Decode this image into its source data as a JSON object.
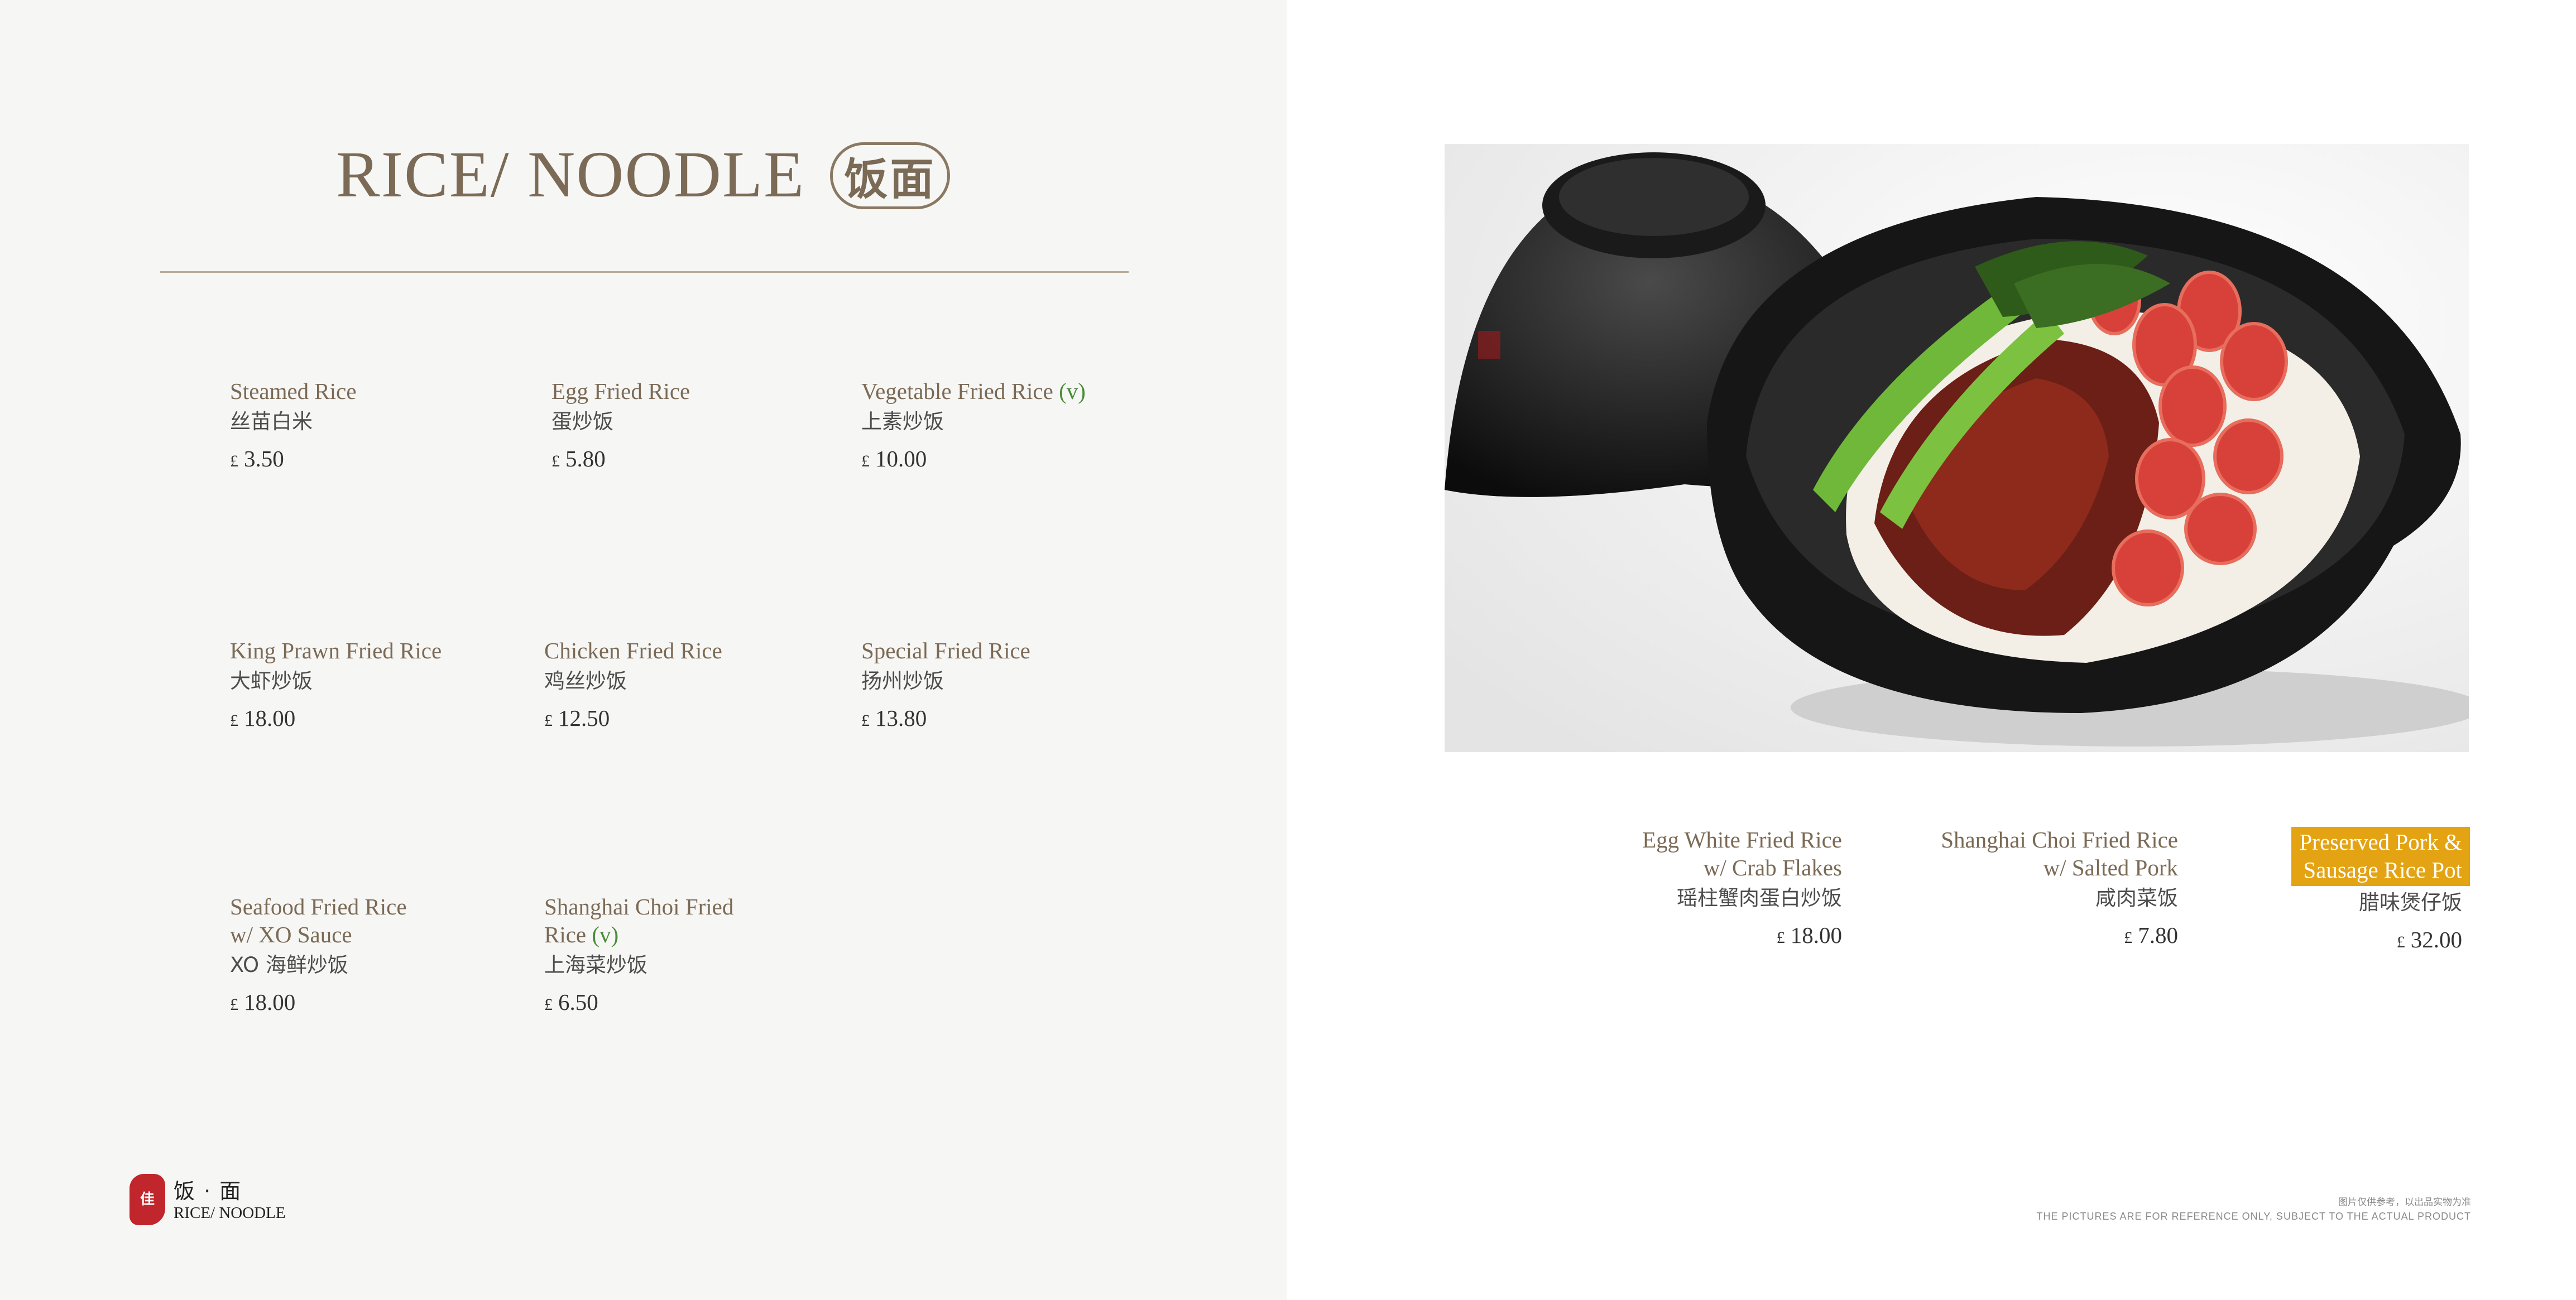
{
  "header": {
    "title": "RICE/ NOODLE",
    "badge": "饭面"
  },
  "menu_left": [
    {
      "en": "Steamed Rice",
      "veg": "",
      "cn": "丝苗白米",
      "currency": "£",
      "price": "3.50"
    },
    {
      "en": "Egg Fried Rice",
      "veg": "",
      "cn": "蛋炒饭",
      "currency": "£",
      "price": "5.80"
    },
    {
      "en": "Vegetable Fried Rice",
      "veg": "(v)",
      "cn": "上素炒饭",
      "currency": "£",
      "price": "10.00"
    },
    {
      "en": "King Prawn Fried Rice",
      "veg": "",
      "cn": "大虾炒饭",
      "currency": "£",
      "price": "18.00"
    },
    {
      "en": "Chicken Fried Rice",
      "veg": "",
      "cn": "鸡丝炒饭",
      "currency": "£",
      "price": "12.50"
    },
    {
      "en": "Special Fried Rice",
      "veg": "",
      "cn": "扬州炒饭",
      "currency": "£",
      "price": "13.80"
    },
    {
      "en": "Seafood Fried Rice",
      "en2": "w/ XO Sauce",
      "veg": "",
      "cn": "XO 海鲜炒饭",
      "currency": "£",
      "price": "18.00"
    },
    {
      "en": "Shanghai Choi Fried",
      "en2": "Rice",
      "veg": "(v)",
      "cn": "上海菜炒饭",
      "currency": "£",
      "price": "6.50"
    }
  ],
  "menu_right": [
    {
      "en": "Egg White Fried Rice",
      "en2": "w/ Crab Flakes",
      "cn": "瑶柱蟹肉蛋白炒饭",
      "currency": "£",
      "price": "18.00"
    },
    {
      "en": "Shanghai Choi Fried Rice",
      "en2": "w/ Salted Pork",
      "cn": "咸肉菜饭",
      "currency": "£",
      "price": "7.80"
    },
    {
      "en": "Preserved Pork &",
      "en2": "Sausage Rice Pot",
      "cn": "腊味煲仔饭",
      "currency": "£",
      "price": "32.00"
    }
  ],
  "footer": {
    "seal_text": "佳",
    "cn": "饭 · 面",
    "en": "RICE/ NOODLE"
  },
  "disclaimer": {
    "cn": "图片仅供参考，以出品实物为准",
    "en": "THE PICTURES ARE FOR REFERENCE ONLY, SUBJECT TO THE ACTUAL PRODUCT"
  },
  "colors": {
    "title": "#7b6a55",
    "veg": "#4a8c3a",
    "highlight": "#e3a313",
    "left_background": "#f6f6f5"
  },
  "icons": {
    "photo": "clay-pot-rice-photo",
    "seal": "restaurant-seal-icon"
  }
}
